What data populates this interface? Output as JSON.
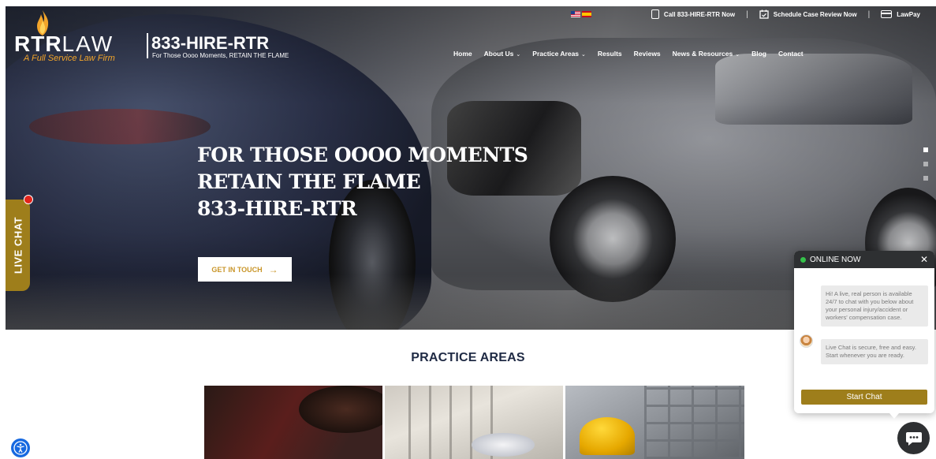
{
  "brand": {
    "logo_main": "RTR",
    "logo_law": "LAW",
    "tagline": "A Full Service Law Firm",
    "phone": "833-HIRE-RTR",
    "slogan": "For Those Oooo Moments, RETAIN THE FLAME"
  },
  "topbar": {
    "call_label": "Call 833-HIRE-RTR Now",
    "schedule_label": "Schedule Case Review Now",
    "pay_label": "LawPay",
    "separator": "|"
  },
  "nav": {
    "items": [
      {
        "label": "Home",
        "has_caret": false
      },
      {
        "label": "About Us",
        "has_caret": true
      },
      {
        "label": "Practice Areas",
        "has_caret": true
      },
      {
        "label": "Results",
        "has_caret": false
      },
      {
        "label": "Reviews",
        "has_caret": false
      },
      {
        "label": "News & Resources",
        "has_caret": true
      },
      {
        "label": "Blog",
        "has_caret": false
      },
      {
        "label": "Contact",
        "has_caret": false
      }
    ],
    "caret": "⌄"
  },
  "hero": {
    "line1": "FOR THOSE OOOO MOMENTS",
    "line2": "RETAIN THE FLAME",
    "line3": "833-HIRE-RTR",
    "cta_label": "GET IN TOUCH",
    "cta_arrow": "→"
  },
  "live_chat_tab": {
    "label": "LIVE CHAT"
  },
  "practice": {
    "title": "PRACTICE AREAS"
  },
  "chat_widget": {
    "status": "ONLINE NOW",
    "close": "✕",
    "message1": "Hi! A live, real person is available 24/7 to chat with you below about your personal injury/accident or workers' compensation case.",
    "message2": "Live Chat is secure, free and easy. Start whenever you are ready.",
    "start_button": "Start Chat"
  },
  "colors": {
    "accent_gold": "#9e7e1b",
    "cta_text": "#c9962a",
    "tagline_orange": "#f3a52a",
    "heading_navy": "#1f2a44",
    "online_green": "#35c24a",
    "a11y_blue": "#1769e0"
  },
  "icons": {
    "flame": "flame-icon",
    "phone": "phone-icon",
    "calendar": "calendar-check-icon",
    "card": "credit-card-icon",
    "arrow": "arrow-right-icon",
    "chat": "chat-bubble-icon",
    "accessibility": "accessibility-icon"
  }
}
